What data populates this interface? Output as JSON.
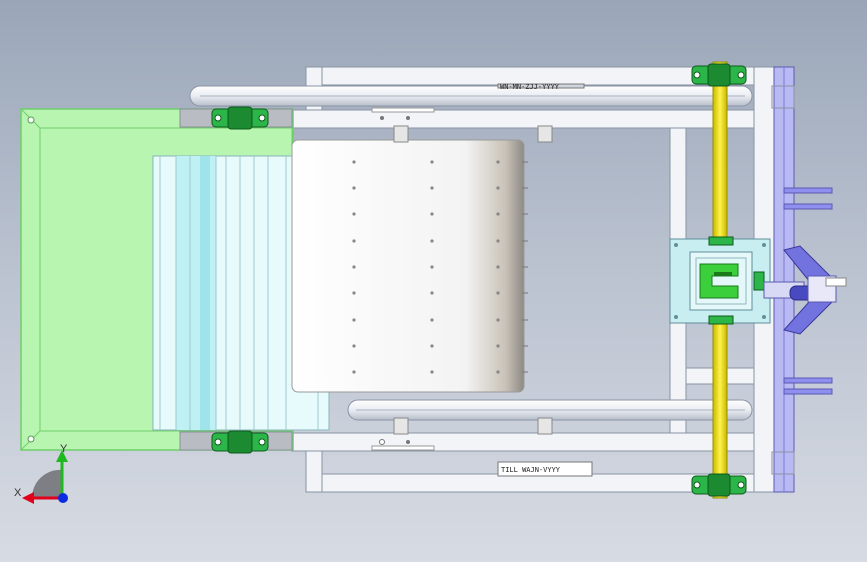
{
  "view": {
    "background_top": "#9aa6b8",
    "background_bottom": "#d7dbe3"
  },
  "triad": {
    "x_label": "X",
    "y_label": "Y",
    "x_color": "#e0001b",
    "y_color": "#1fb81f",
    "z_color": "#0a2be0"
  },
  "colors": {
    "frame": "#f2f4f8",
    "frame_edge": "#8a94a4",
    "hopper": "#b8f5b0",
    "hopper_edge": "#6fcf6a",
    "screen": "#d8f6f8",
    "bearing": "#1fa83a",
    "shaft": "#f5e60a",
    "gearbox": "#c9eef2",
    "bracket": "#8f8ff0",
    "drum": "#f7f7f7"
  },
  "model": {
    "nameplate_top": "WN-MN-ZJJ-YYYY",
    "nameplate_bottom": "TILL WAJN-VYYY"
  }
}
